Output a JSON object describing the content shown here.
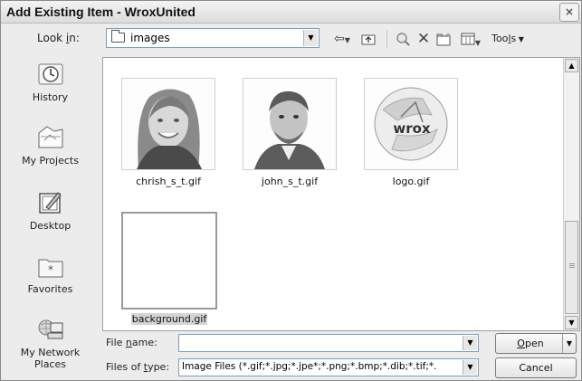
{
  "window": {
    "title": "Add Existing Item - WroxUnited",
    "close_glyph": "×"
  },
  "lookin": {
    "label_pre": "Look ",
    "label_ul": "i",
    "label_post": "n:",
    "value": "images"
  },
  "toolbar": {
    "back_icon": "back-arrow-icon",
    "up_icon": "up-folder-icon",
    "search_icon": "search-web-icon",
    "delete_icon": "delete-icon",
    "newfolder_icon": "new-folder-icon",
    "views_icon": "views-icon",
    "tools_pre": "Too",
    "tools_ul": "l",
    "tools_post": "s"
  },
  "places": [
    {
      "label": "History",
      "icon": "history-icon"
    },
    {
      "label": "My Projects",
      "icon": "my-projects-icon"
    },
    {
      "label": "Desktop",
      "icon": "desktop-icon"
    },
    {
      "label": "Favorites",
      "icon": "favorites-icon"
    },
    {
      "label_line1": "My Network",
      "label_line2": "Places",
      "icon": "network-places-icon"
    }
  ],
  "files": [
    {
      "name": "chrish_s_t.gif"
    },
    {
      "name": "john_s_t.gif"
    },
    {
      "name": "logo.gif",
      "logo_text": "wrox"
    },
    {
      "name": "background.gif"
    }
  ],
  "filename": {
    "label_pre": "File ",
    "label_ul": "n",
    "label_post": "ame:",
    "value": ""
  },
  "filetype": {
    "label_pre": "Files of ",
    "label_ul": "t",
    "label_post": "ype:",
    "value": "Image Files (*.gif;*.jpg;*.jpe*;*.png;*.bmp;*.dib;*.tif;*."
  },
  "buttons": {
    "open_ul": "O",
    "open_post": "pen",
    "cancel": "Cancel"
  },
  "colors": {
    "accent": "#7f9db9",
    "selection": "#d4d4d4"
  }
}
